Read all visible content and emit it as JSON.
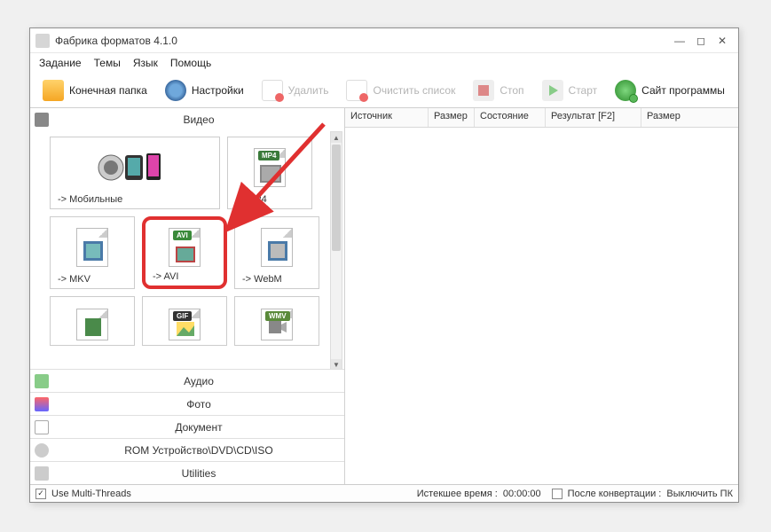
{
  "title": "Фабрика форматов 4.1.0",
  "menu": {
    "task": "Задание",
    "themes": "Темы",
    "lang": "Язык",
    "help": "Помощь"
  },
  "toolbar": {
    "dest": "Конечная папка",
    "settings": "Настройки",
    "delete": "Удалить",
    "clear": "Очистить список",
    "stop": "Стоп",
    "start": "Старт",
    "site": "Сайт программы"
  },
  "categories": {
    "video": "Видео",
    "audio": "Аудио",
    "photo": "Фото",
    "document": "Документ",
    "rom": "ROM Устройство\\DVD\\CD\\ISO",
    "utilities": "Utilities"
  },
  "formats": {
    "mobile": "-> Мобильные",
    "mp4": "-> MP4",
    "mkv": "-> MKV",
    "avi": "-> AVI",
    "webm": "-> WebM"
  },
  "tags": {
    "mp4": "MP4",
    "avi": "AVI",
    "gif": "GIF",
    "wmv": "WMV"
  },
  "columns": {
    "source": "Источник",
    "size": "Размер",
    "state": "Состояние",
    "result": "Результат [F2]",
    "size2": "Размер"
  },
  "status": {
    "multi": "Use Multi-Threads",
    "elapsed_label": "Истекшее время :",
    "elapsed_value": "00:00:00",
    "after_label": "После конвертации :",
    "after_value": "Выключить ПК"
  }
}
